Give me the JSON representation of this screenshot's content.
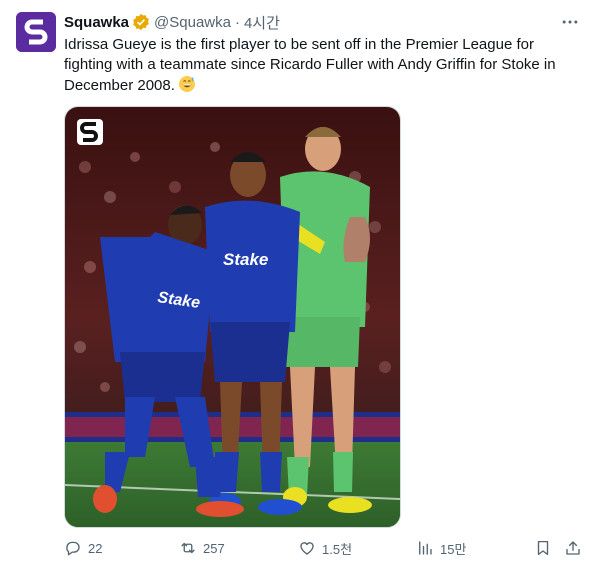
{
  "tweet": {
    "author_name": "Squawka",
    "handle": "@Squawka",
    "separator": "·",
    "time": "4시간",
    "text": "Idrissa Gueye is the first player to be sent off in the Premier League for fighting with a teammate since Ricardo Fuller with Andy Griffin for Stoke in December 2008.",
    "emoji": "grinning-sweat-emoji"
  },
  "media": {
    "logo_icon": "squawka-logo-icon",
    "jersey_sponsor_text": "Stake"
  },
  "actions": {
    "reply_count": "22",
    "retweet_count": "257",
    "like_count": "1.5천",
    "view_count": "15만"
  },
  "colors": {
    "brand": "#5a2ca0",
    "verified_badge": "#e9a900",
    "secondary_text": "#536471",
    "everton_blue": "#1f3db0",
    "keeper_green": "#5cc46f"
  }
}
